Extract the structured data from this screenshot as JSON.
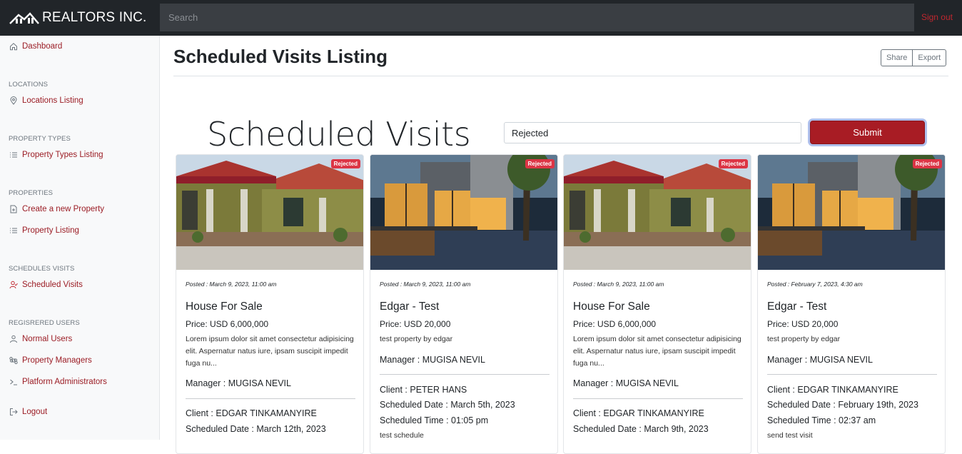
{
  "brand": {
    "name": "REALTORS INC."
  },
  "search": {
    "placeholder": "Search"
  },
  "nav": {
    "signout": "Sign out"
  },
  "sidebar": {
    "dashboard": "Dashboard",
    "locations_head": "LOCATIONS",
    "locations_listing": "Locations Listing",
    "ptypes_head": "PROPERTY TYPES",
    "ptypes_listing": "Property Types Listing",
    "properties_head": "PROPERTIES",
    "create_property": "Create a new Property",
    "property_listing": "Property Listing",
    "schedules_head": "SCHEDULES VISITS",
    "scheduled_visits": "Scheduled Visits",
    "users_head": "REGISRERED USERS",
    "normal_users": "Normal Users",
    "property_managers": "Property Managers",
    "platform_admins": "Platform Administrators",
    "logout": "Logout"
  },
  "page": {
    "title": "Scheduled Visits Listing",
    "share": "Share",
    "export": "Export",
    "heading": "Scheduled Visits",
    "filter_value": "Rejected",
    "submit": "Submit"
  },
  "cards": [
    {
      "status": "Rejected",
      "posted": "Posted : March 9, 2023, 11:00 am",
      "title": "House For Sale",
      "price": "Price: USD 6,000,000",
      "description": "Lorem ipsum dolor sit amet consectetur adipisicing elit. Aspernatur natus iure, ipsam suscipit impedit fuga nu...",
      "manager": "Manager : MUGISA NEVIL",
      "client": "Client : EDGAR TINKAMANYIRE",
      "date": "Scheduled Date : March 12th, 2023",
      "time": "",
      "note": ""
    },
    {
      "status": "Rejected",
      "posted": "Posted : March 9, 2023, 11:00 am",
      "title": "Edgar - Test",
      "price": "Price: USD 20,000",
      "description": "test property by edgar",
      "manager": "Manager : MUGISA NEVIL",
      "client": "Client : PETER HANS",
      "date": "Scheduled Date : March 5th, 2023",
      "time": "Scheduled Time : 01:05 pm",
      "note": "test schedule"
    },
    {
      "status": "Rejected",
      "posted": "Posted : March 9, 2023, 11:00 am",
      "title": "House For Sale",
      "price": "Price: USD 6,000,000",
      "description": "Lorem ipsum dolor sit amet consectetur adipisicing elit. Aspernatur natus iure, ipsam suscipit impedit fuga nu...",
      "manager": "Manager : MUGISA NEVIL",
      "client": "Client : EDGAR TINKAMANYIRE",
      "date": "Scheduled Date : March 9th, 2023",
      "time": "",
      "note": ""
    },
    {
      "status": "Rejected",
      "posted": "Posted : February 7, 2023, 4:30 am",
      "title": "Edgar - Test",
      "price": "Price: USD 20,000",
      "description": "test property by edgar",
      "manager": "Manager : MUGISA NEVIL",
      "client": "Client : EDGAR TINKAMANYIRE",
      "date": "Scheduled Date : February 19th, 2023",
      "time": "Scheduled Time : 02:37 am",
      "note": "send test visit"
    }
  ]
}
